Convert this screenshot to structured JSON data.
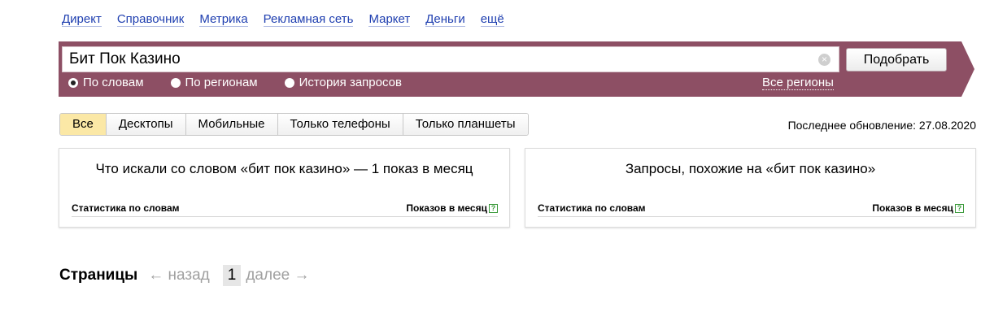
{
  "top_nav": [
    "Директ",
    "Справочник",
    "Метрика",
    "Рекламная сеть",
    "Маркет",
    "Деньги",
    "ещё"
  ],
  "search": {
    "value": "Бит Пок Казино",
    "submit_label": "Подобрать",
    "clear_icon": "×"
  },
  "modes": [
    {
      "label": "По словам",
      "checked": true
    },
    {
      "label": "По регионам",
      "checked": false
    },
    {
      "label": "История запросов",
      "checked": false
    }
  ],
  "regions_link": "Все регионы",
  "device_tabs": [
    {
      "label": "Все",
      "active": true
    },
    {
      "label": "Десктопы",
      "active": false
    },
    {
      "label": "Мобильные",
      "active": false
    },
    {
      "label": "Только телефоны",
      "active": false
    },
    {
      "label": "Только планшеты",
      "active": false
    }
  ],
  "last_update": "Последнее обновление: 27.08.2020",
  "panels": {
    "left": {
      "title": "Что искали со словом «бит пок казино» — 1 показ в месяц",
      "col_keyword": "Статистика по словам",
      "col_impressions": "Показов в месяц",
      "help_icon": "?"
    },
    "right": {
      "title": "Запросы, похожие на «бит пок казино»",
      "col_keyword": "Статистика по словам",
      "col_impressions": "Показов в месяц",
      "help_icon": "?"
    }
  },
  "pagination": {
    "label": "Страницы",
    "prev": "← назад",
    "current": "1",
    "next": "далее →"
  },
  "colors": {
    "band": "#8d4f64",
    "active_tab": "#fbe8a6",
    "link": "#1f3fb0"
  }
}
